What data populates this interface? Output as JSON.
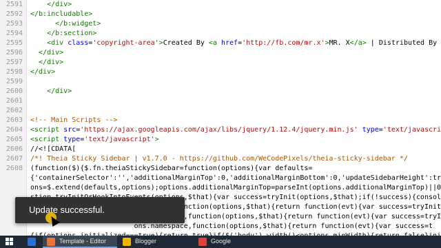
{
  "editor": {
    "lines": [
      {
        "num": "2591",
        "tokens": [
          {
            "t": "    </div>",
            "c": "tag"
          }
        ]
      },
      {
        "num": "2592",
        "tokens": [
          {
            "t": "</b:includable>",
            "c": "tag"
          }
        ]
      },
      {
        "num": "2593",
        "tokens": [
          {
            "t": "      </b:widget>",
            "c": "tag"
          }
        ]
      },
      {
        "num": "2594",
        "tokens": [
          {
            "t": "    </b:section>",
            "c": "tag"
          }
        ]
      },
      {
        "num": "2595",
        "tokens": [
          {
            "t": "    <div ",
            "c": "tag"
          },
          {
            "t": "class",
            "c": "attr"
          },
          {
            "t": "=",
            "c": "plain"
          },
          {
            "t": "'copyright-area'",
            "c": "str"
          },
          {
            "t": ">",
            "c": "tag"
          },
          {
            "t": "Created By ",
            "c": "plain"
          },
          {
            "t": "<a ",
            "c": "tag"
          },
          {
            "t": "href",
            "c": "attr"
          },
          {
            "t": "=",
            "c": "plain"
          },
          {
            "t": "'http://fb.com/mr.x'",
            "c": "str"
          },
          {
            "t": ">",
            "c": "tag"
          },
          {
            "t": "MR. X",
            "c": "plain"
          },
          {
            "t": "</a>",
            "c": "tag"
          },
          {
            "t": " | Distributed By ",
            "c": "plain"
          },
          {
            "t": "<a ",
            "c": "tag"
          },
          {
            "t": "href",
            "c": "attr"
          },
          {
            "t": "=",
            "c": "plain"
          },
          {
            "t": "'http://",
            "c": "str"
          }
        ]
      },
      {
        "num": "2596",
        "tokens": [
          {
            "t": "  </div>",
            "c": "tag"
          }
        ]
      },
      {
        "num": "2597",
        "tokens": [
          {
            "t": "  </div>",
            "c": "tag"
          }
        ]
      },
      {
        "num": "2598",
        "tokens": [
          {
            "t": "</div>",
            "c": "tag"
          }
        ]
      },
      {
        "num": "2599",
        "tokens": []
      },
      {
        "num": "2600",
        "tokens": [
          {
            "t": "    </div>",
            "c": "tag"
          }
        ]
      },
      {
        "num": "2601",
        "tokens": []
      },
      {
        "num": "2602",
        "tokens": []
      },
      {
        "num": "2603",
        "tokens": [
          {
            "t": "<!-- Main Scripts -->",
            "c": "cmt"
          }
        ]
      },
      {
        "num": "2604",
        "tokens": [
          {
            "t": "<script ",
            "c": "tag"
          },
          {
            "t": "src",
            "c": "attr"
          },
          {
            "t": "=",
            "c": "plain"
          },
          {
            "t": "'https://ajax.googleapis.com/ajax/libs/jquery/1.12.4/jquery.min.js'",
            "c": "str"
          },
          {
            "t": " ",
            "c": "plain"
          },
          {
            "t": "type",
            "c": "attr"
          },
          {
            "t": "=",
            "c": "plain"
          },
          {
            "t": "'text/javascript'",
            "c": "str"
          },
          {
            "t": "/>",
            "c": "tag"
          }
        ]
      },
      {
        "num": "2605",
        "tokens": [
          {
            "t": "<script ",
            "c": "tag"
          },
          {
            "t": "type",
            "c": "attr"
          },
          {
            "t": "=",
            "c": "plain"
          },
          {
            "t": "'text/javascript'",
            "c": "str"
          },
          {
            "t": ">",
            "c": "tag"
          }
        ]
      },
      {
        "num": "2606",
        "tokens": [
          {
            "t": "//<![CDATA[",
            "c": "plain"
          }
        ]
      },
      {
        "num": "2607",
        "tokens": [
          {
            "t": "/*! Theia Sticky Sidebar | v1.7.0 - https://github.com/WeCodePixels/theia-sticky-sidebar */",
            "c": "cmt"
          }
        ]
      },
      {
        "num": "2608",
        "tokens": [
          {
            "t": "(function($){$.fn.theiaStickySidebar=function(options){var defaults=",
            "c": "plain"
          }
        ]
      },
      {
        "num": "",
        "tokens": [
          {
            "t": "{'containerSelector':'','additionalMarginTop':0,'additionalMarginBottom':0,'updateSidebarHeight':true,'minWidth':0,'disa",
            "c": "plain"
          }
        ]
      },
      {
        "num": "",
        "tokens": [
          {
            "t": "ons=$.extend(defaults,options);options.additionalMarginTop=parseInt(options.additionalMarginTop)||0;options.additio",
            "c": "plain"
          }
        ]
      },
      {
        "num": "",
        "tokens": [
          {
            "t": "stion tryInitOrHookIntoEvents(options,$that){var success=tryInit(options,$that);if(!success){console.log('TSS: Body w",
            "c": "plain"
          }
        ]
      },
      {
        "num": "",
        "tokens": [
          {
            "t": "                         namespace,function(options,$that){return function(evt){var success=tryInit(options,$that",
            "c": "plain"
          }
        ]
      },
      {
        "num": "",
        "tokens": [
          {
            "t": "                         ns.namespace,function(options,$that){return function(evt){var success=tryInit(options,$that",
            "c": "plain"
          }
        ]
      },
      {
        "num": "",
        "tokens": [
          {
            "t": "                         ons.namespace,function(options,$that){return function(evt){var success=t",
            "c": "plain"
          }
        ]
      },
      {
        "num": "",
        "tokens": [
          {
            "t": "{if(options.initialized===true){return true}if($('body').width()<options.minWidth){return false}init(options,$that);retur",
            "c": "plain"
          }
        ]
      },
      {
        "num": "",
        "tokens": [
          {
            "t": "sidebar-stylesheet-'+options.namespace);if(existingStylesheet.length===0){$('head').append($('<style id=\"theia-stick",
            "c": "plain"
          }
        ]
      }
    ]
  },
  "toast": {
    "text": "Update successful."
  },
  "taskbar": {
    "items": [
      {
        "label": "",
        "color": "#2d6fd0",
        "active": false
      },
      {
        "label": "Template - Editor",
        "color": "#e8733a",
        "active": true
      },
      {
        "label": "Blogger",
        "color": "#f4b400",
        "active": false
      },
      {
        "label": "Google",
        "color": "#db4437",
        "active": false
      }
    ]
  },
  "colors": {
    "gutter_bg": "#f2f2f2",
    "toast_bg": "#323232",
    "taskbar_bg": "#1f2a36",
    "tag": "#117700",
    "attr": "#0000cc",
    "string": "#aa1111",
    "comment": "#aa5500"
  }
}
